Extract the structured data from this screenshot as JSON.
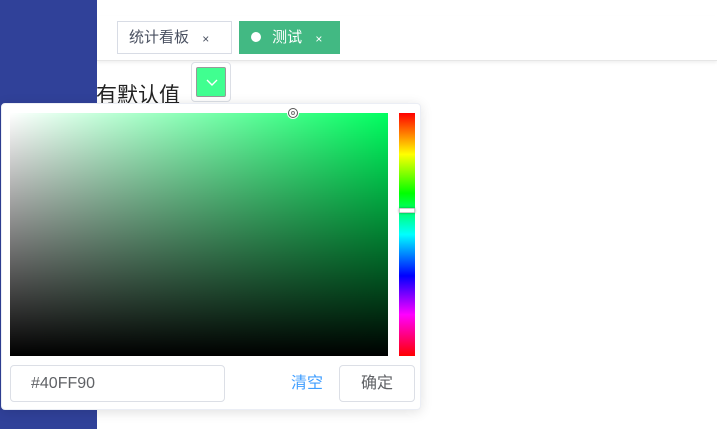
{
  "tags": [
    {
      "label": "统计看板",
      "close": "×",
      "active": false
    },
    {
      "label": "测试",
      "close": "×",
      "active": true
    }
  ],
  "form": {
    "label": "有默认值"
  },
  "color_picker": {
    "current_color": "#40FF90",
    "hue_color": "#00ff60",
    "hex_value": "#40FF90",
    "clear_label": "清空",
    "confirm_label": "确定"
  },
  "colors": {
    "sidebar": "#304199",
    "active_tag": "#42b983",
    "link": "#409eff"
  }
}
